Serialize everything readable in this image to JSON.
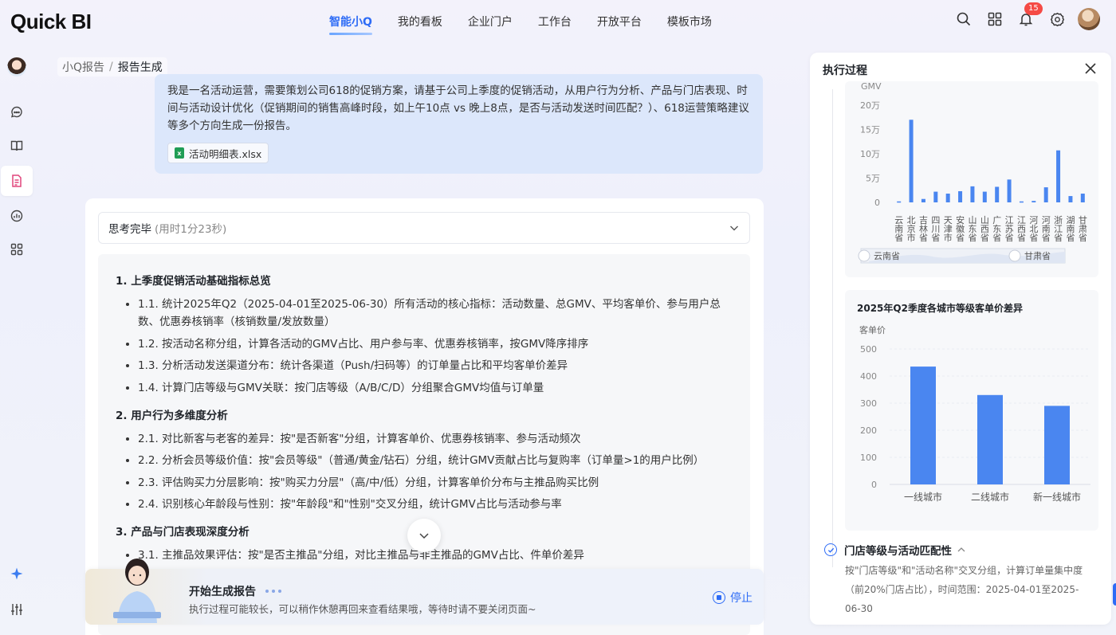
{
  "app": {
    "logo": "Quick BI"
  },
  "nav": {
    "items": [
      "智能小Q",
      "我的看板",
      "企业门户",
      "工作台",
      "开放平台",
      "模板市场"
    ],
    "active": 0
  },
  "header": {
    "notification_count": "15"
  },
  "breadcrumb": {
    "parent": "小Q报告",
    "separator": "/",
    "current": "报告生成"
  },
  "query": {
    "text": "我是一名活动运营，需要策划公司618的促销方案，请基于公司上季度的促销活动，从用户行为分析、产品与门店表现、时间与活动设计优化（促销期间的销售高峰时段，如上午10点 vs 晚上8点，是否与活动发送时间匹配？）、618运营策略建议等多个方向生成一份报告。",
    "attachment": "活动明细表.xlsx"
  },
  "thinking": {
    "label": "思考完毕",
    "duration": "(用时1分23秒)"
  },
  "plan": {
    "sections": [
      {
        "title": "1. 上季度促销活动基础指标总览",
        "items": [
          "1.1. 统计2025年Q2（2025-04-01至2025-06-30）所有活动的核心指标：活动数量、总GMV、平均客单价、参与用户总数、优惠券核销率（核销数量/发放数量）",
          "1.2. 按活动名称分组，计算各活动的GMV占比、用户参与率、优惠券核销率，按GMV降序排序",
          "1.3. 分析活动发送渠道分布：统计各渠道（Push/扫码等）的订单量占比和平均客单价差异",
          "1.4. 计算门店等级与GMV关联：按门店等级（A/B/C/D）分组聚合GMV均值与订单量"
        ]
      },
      {
        "title": "2. 用户行为多维度分析",
        "items": [
          "2.1. 对比新客与老客的差异：按\"是否新客\"分组，计算客单价、优惠券核销率、参与活动频次",
          "2.2. 分析会员等级价值：按\"会员等级\"（普通/黄金/钻石）分组，统计GMV贡献占比与复购率（订单量>1的用户比例）",
          "2.3. 评估购买力分层影响：按\"购买力分层\"（高/中/低）分组，计算客单价分布与主推品购买比例",
          "2.4. 识别核心年龄段与性别：按\"年龄段\"和\"性别\"交叉分组，统计GMV占比与活动参与率"
        ]
      },
      {
        "title": "3. 产品与门店表现深度分析",
        "items": [
          "3.1. 主推品效果评估：按\"是否主推品\"分组，对比主推品与非主推品的GMV占比、件单价差异"
        ]
      }
    ]
  },
  "generating": {
    "title": "开始生成报告",
    "subtitle": "执行过程可能较长，可以稍作休憩再回来查看结果哦，等待时请不要关闭页面~",
    "stop_label": "停止"
  },
  "panel": {
    "title": "执行过程",
    "step": {
      "title": "门店等级与活动匹配性",
      "desc": "按\"门店等级\"和\"活动名称\"交叉分组，计算订单量集中度（前20%门店占比），时间范围：2025-04-01至2025-06-30"
    }
  },
  "chart_data": [
    {
      "type": "bar",
      "title": "",
      "ylabel": "GMV",
      "yticks": [
        "0",
        "5万",
        "10万",
        "15万",
        "20万"
      ],
      "ylim": [
        0,
        200000
      ],
      "categories": [
        "云南省",
        "北京市",
        "吉林省",
        "四川省",
        "天津市",
        "安徽省",
        "山东省",
        "山西省",
        "广东省",
        "江苏省",
        "江西省",
        "河北省",
        "河南省",
        "浙江省",
        "湖南省",
        "甘肃省"
      ],
      "values": [
        2000,
        170000,
        7000,
        22000,
        18000,
        23000,
        33000,
        22000,
        32000,
        47000,
        2000,
        3000,
        31000,
        107000,
        13000,
        18000
      ],
      "slider": {
        "start": "云南省",
        "end": "甘肃省"
      },
      "color": "#4a86f0"
    },
    {
      "type": "bar",
      "title": "2025年Q2季度各城市等级客单价差异",
      "ylabel": "客单价",
      "ylim": [
        0,
        500
      ],
      "yticks": [
        "0",
        "100",
        "200",
        "300",
        "400",
        "500"
      ],
      "categories": [
        "一线城市",
        "二线城市",
        "新一线城市"
      ],
      "values": [
        435,
        330,
        290
      ],
      "color": "#4a86f0"
    }
  ]
}
